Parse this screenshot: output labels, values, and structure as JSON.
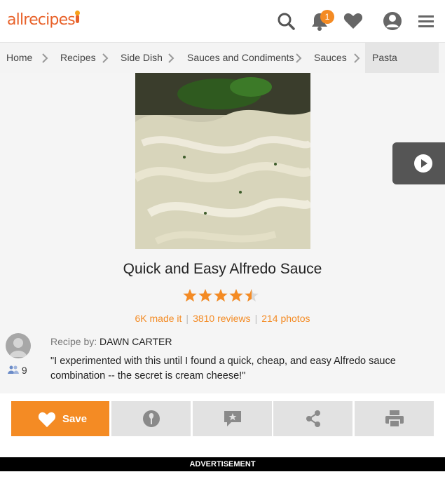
{
  "header": {
    "logo_text": "allrecipes",
    "notification_count": "1",
    "icons": [
      "search-icon",
      "bell-icon",
      "heart-icon",
      "user-icon",
      "menu-icon"
    ]
  },
  "breadcrumb": {
    "items": [
      "Home",
      "Recipes",
      "Side Dish",
      "Sauces and Condiments",
      "Sauces",
      "Pasta Sauces"
    ]
  },
  "recipe": {
    "title": "Quick and Easy Alfredo Sauce",
    "rating": 4.5,
    "made_it": "6K made it",
    "reviews": "3810 reviews",
    "photos": "214 photos",
    "byline_label": "Recipe by:",
    "author": "DAWN CARTER",
    "followers": "9",
    "description": "\"I experimented with this until I found a quick, cheap, and easy Alfredo sauce combination -- the secret is cream cheese!\""
  },
  "actions": {
    "save_label": "Save",
    "icons": [
      "heart-icon",
      "made-it-icon",
      "review-icon",
      "share-icon",
      "print-icon"
    ]
  },
  "ad_label": "ADVERTISEMENT",
  "colors": {
    "accent": "#f48b24",
    "logo": "#e8622a",
    "action_bg": "#e2e2e2"
  }
}
